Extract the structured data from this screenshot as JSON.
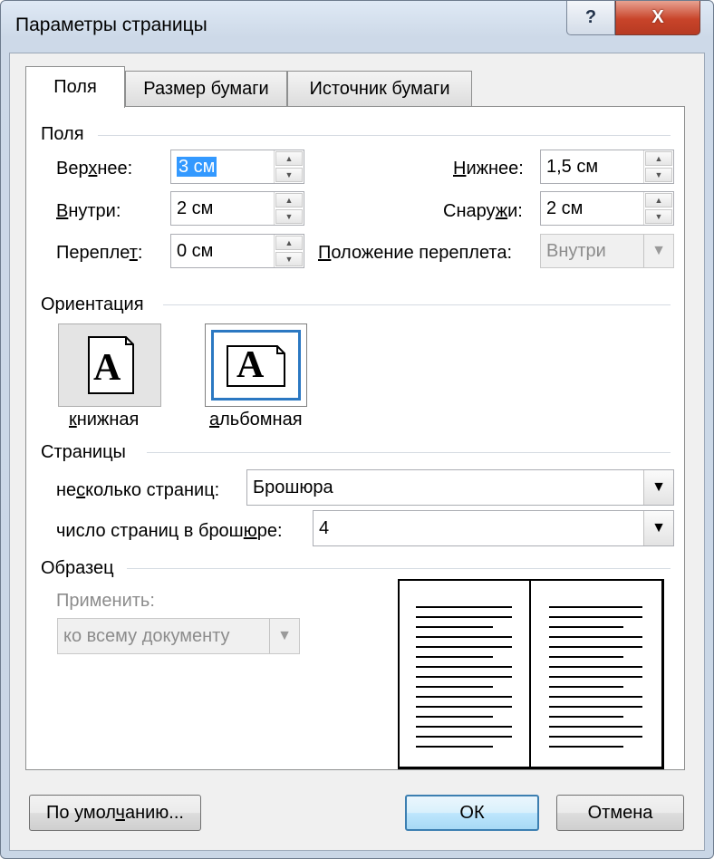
{
  "window": {
    "title": "Параметры страницы",
    "help": "?",
    "close": "X"
  },
  "tabs": [
    {
      "label": "Поля",
      "active": true
    },
    {
      "label": "Размер бумаги",
      "active": false
    },
    {
      "label": "Источник бумаги",
      "active": false
    }
  ],
  "margins": {
    "heading": "Поля",
    "top": {
      "label_a": "Вер",
      "label_u": "х",
      "label_b": "нее:",
      "value": "3 см"
    },
    "bottom": {
      "label_a": "",
      "label_u": "Н",
      "label_b": "ижнее:",
      "value": "1,5 см"
    },
    "inside": {
      "label_a": "",
      "label_u": "В",
      "label_b": "нутри:",
      "value": "2 см"
    },
    "outside": {
      "label_a": "Снару",
      "label_u": "ж",
      "label_b": "и:",
      "value": "2 см"
    },
    "gutter": {
      "label_a": "Перепле",
      "label_u": "т",
      "label_b": ":",
      "value": "0 см"
    },
    "gutter_pos": {
      "label_a": "",
      "label_u": "П",
      "label_b": "оложение переплета:",
      "value": "Внутри"
    }
  },
  "orientation": {
    "heading": "Ориентация",
    "portrait": {
      "label_a": "",
      "label_u": "к",
      "label_b": "нижная",
      "glyph": "A"
    },
    "landscape": {
      "label_a": "",
      "label_u": "а",
      "label_b": "льбомная",
      "glyph": "A"
    }
  },
  "pages": {
    "heading": "Страницы",
    "multiple": {
      "label_a": "не",
      "label_u": "с",
      "label_b": "колько страниц:",
      "value": "Брошюра"
    },
    "booklet": {
      "label_a": "число страниц в брош",
      "label_u": "ю",
      "label_b": "ре:",
      "value": "4"
    }
  },
  "preview": {
    "heading": "Образец",
    "apply_label": "Применить:",
    "apply_value": "ко всему документу"
  },
  "buttons": {
    "default_a": "По умол",
    "default_u": "ч",
    "default_b": "анию...",
    "ok": "ОК",
    "cancel": "Отмена"
  },
  "icons": {
    "spin_up": "▲",
    "spin_down": "▼",
    "dropdown": "▼"
  }
}
